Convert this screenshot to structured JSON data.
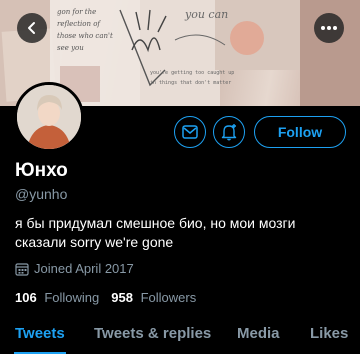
{
  "profile": {
    "name": "Юнхо",
    "handle": "@yunho",
    "bio_line1": "я бы придумал смешное био, но мои мозги",
    "bio_line2": "сказали sorry we're gone",
    "joined": "Joined April 2017"
  },
  "banner": {
    "note_left_1": "gon for the",
    "note_left_2": "reflection of",
    "note_left_3": "those who can't",
    "note_left_4": "see you",
    "note_top": "you can",
    "note_mid_1": "you're getting too caught up",
    "note_mid_2": "in things that don't matter"
  },
  "actions": {
    "follow_label": "Follow"
  },
  "stats": {
    "following_count": "106",
    "following_label": "Following",
    "followers_count": "958",
    "followers_label": "Followers"
  },
  "tabs": {
    "tweets": "Tweets",
    "replies": "Tweets & replies",
    "media": "Media",
    "likes": "Likes"
  },
  "colors": {
    "accent": "#1da1f2",
    "muted": "#8899a6",
    "background": "#000000"
  },
  "icons": {
    "back": "arrow-left-icon",
    "more": "more-dots-icon",
    "message": "envelope-icon",
    "notify": "bell-plus-icon",
    "calendar": "calendar-icon"
  }
}
